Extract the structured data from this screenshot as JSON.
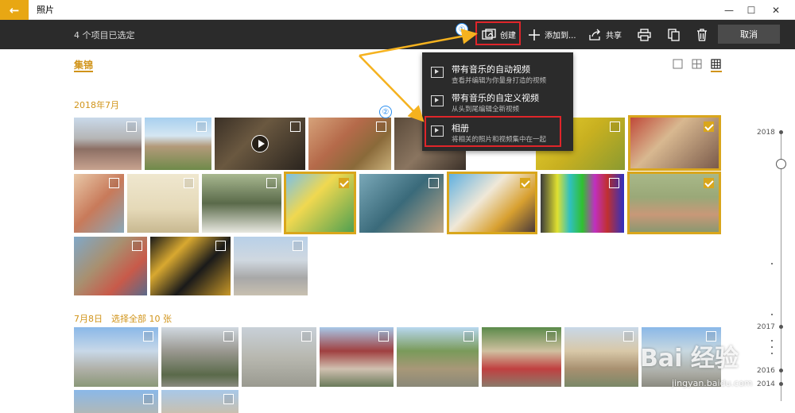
{
  "window": {
    "back_glyph": "←",
    "title": "照片",
    "controls": {
      "minimize": "—",
      "maximize": "☐",
      "close": "✕"
    }
  },
  "toolbar": {
    "selection_count": "4 个项目已选定",
    "create_label": "创建",
    "add_to_label": "添加到...",
    "share_label": "共享",
    "cancel_label": "取消"
  },
  "annotations": {
    "step1": "①",
    "step2": "②",
    "arrow_color": "#f5b21f",
    "highlight_color": "#e0252a"
  },
  "create_menu": {
    "items": [
      {
        "title": "带有音乐的自动视频",
        "desc": "查看并编辑为你量身打造的视频"
      },
      {
        "title": "带有音乐的自定义视频",
        "desc": "从头到尾编辑全新视频"
      },
      {
        "title": "相册",
        "desc": "将相关的照片和视频集中在一起"
      }
    ]
  },
  "content": {
    "section_title": "集锦",
    "date_group1": "2018年7月",
    "date_group2": "7月8日",
    "select_all": "选择全部 10 张"
  },
  "timeline": {
    "years": [
      "2018",
      "2017",
      "2016",
      "2014"
    ]
  },
  "watermark": {
    "text": "Bai 经验",
    "url": "jingyan.baidu.com"
  },
  "colors": {
    "accent": "#d1941a",
    "selected_border": "#d9a61c",
    "toolbar_bg": "#2b2b2b"
  }
}
